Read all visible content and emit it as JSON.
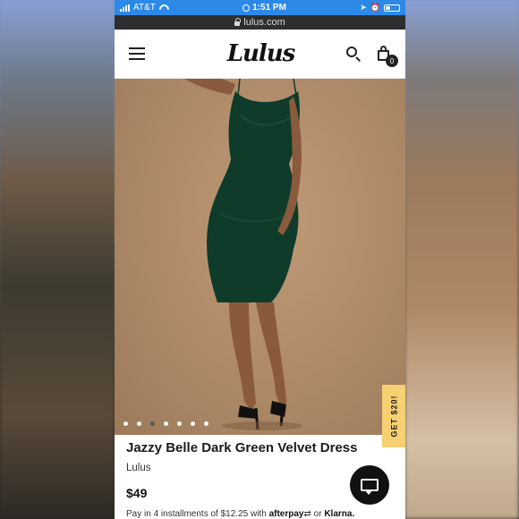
{
  "status_bar": {
    "carrier": "AT&T",
    "time": "1:51 PM",
    "signal_icon": "signal-bars-icon",
    "wifi_icon": "wifi-icon",
    "battery_icon": "battery-icon"
  },
  "browser": {
    "url": "lulus.com",
    "lock_icon": "lock-icon"
  },
  "header": {
    "logo": "Lulus",
    "menu_icon": "hamburger-menu-icon",
    "search_icon": "search-icon",
    "bag_icon": "shopping-bag-icon",
    "bag_count": "0"
  },
  "hero": {
    "dots_total": 7,
    "active_dot": 2
  },
  "promo": {
    "label": "GET $20!"
  },
  "product": {
    "name": "Jazzy Belle Dark Green Velvet Dress",
    "brand": "Lulus",
    "price": "$49",
    "installments_prefix": "Pay in 4 installments of",
    "installments_amount": "$12.25",
    "installments_with": "with",
    "afterpay": "afterpay",
    "or": "or",
    "klarna": "Klarna."
  },
  "chat": {
    "icon": "chat-bubble-icon"
  },
  "colors": {
    "status_bar": "#2c89e8",
    "url_bar": "#2e2e30",
    "hero_bg": "#b08c6a",
    "dress": "#0f3b2a",
    "promo": "#f6d071"
  }
}
